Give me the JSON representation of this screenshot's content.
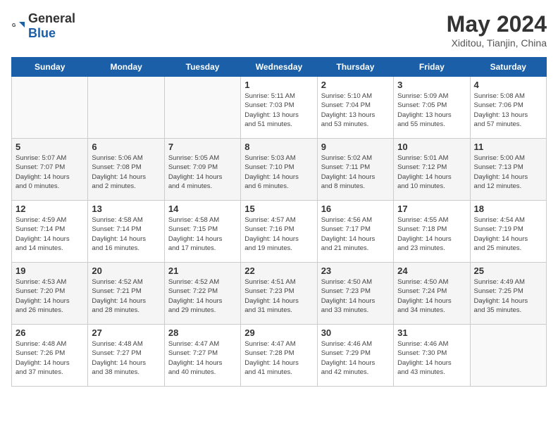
{
  "header": {
    "logo_general": "General",
    "logo_blue": "Blue",
    "title": "May 2024",
    "subtitle": "Xiditou, Tianjin, China"
  },
  "weekdays": [
    "Sunday",
    "Monday",
    "Tuesday",
    "Wednesday",
    "Thursday",
    "Friday",
    "Saturday"
  ],
  "weeks": [
    [
      {
        "day": "",
        "info": ""
      },
      {
        "day": "",
        "info": ""
      },
      {
        "day": "",
        "info": ""
      },
      {
        "day": "1",
        "info": "Sunrise: 5:11 AM\nSunset: 7:03 PM\nDaylight: 13 hours\nand 51 minutes."
      },
      {
        "day": "2",
        "info": "Sunrise: 5:10 AM\nSunset: 7:04 PM\nDaylight: 13 hours\nand 53 minutes."
      },
      {
        "day": "3",
        "info": "Sunrise: 5:09 AM\nSunset: 7:05 PM\nDaylight: 13 hours\nand 55 minutes."
      },
      {
        "day": "4",
        "info": "Sunrise: 5:08 AM\nSunset: 7:06 PM\nDaylight: 13 hours\nand 57 minutes."
      }
    ],
    [
      {
        "day": "5",
        "info": "Sunrise: 5:07 AM\nSunset: 7:07 PM\nDaylight: 14 hours\nand 0 minutes."
      },
      {
        "day": "6",
        "info": "Sunrise: 5:06 AM\nSunset: 7:08 PM\nDaylight: 14 hours\nand 2 minutes."
      },
      {
        "day": "7",
        "info": "Sunrise: 5:05 AM\nSunset: 7:09 PM\nDaylight: 14 hours\nand 4 minutes."
      },
      {
        "day": "8",
        "info": "Sunrise: 5:03 AM\nSunset: 7:10 PM\nDaylight: 14 hours\nand 6 minutes."
      },
      {
        "day": "9",
        "info": "Sunrise: 5:02 AM\nSunset: 7:11 PM\nDaylight: 14 hours\nand 8 minutes."
      },
      {
        "day": "10",
        "info": "Sunrise: 5:01 AM\nSunset: 7:12 PM\nDaylight: 14 hours\nand 10 minutes."
      },
      {
        "day": "11",
        "info": "Sunrise: 5:00 AM\nSunset: 7:13 PM\nDaylight: 14 hours\nand 12 minutes."
      }
    ],
    [
      {
        "day": "12",
        "info": "Sunrise: 4:59 AM\nSunset: 7:14 PM\nDaylight: 14 hours\nand 14 minutes."
      },
      {
        "day": "13",
        "info": "Sunrise: 4:58 AM\nSunset: 7:14 PM\nDaylight: 14 hours\nand 16 minutes."
      },
      {
        "day": "14",
        "info": "Sunrise: 4:58 AM\nSunset: 7:15 PM\nDaylight: 14 hours\nand 17 minutes."
      },
      {
        "day": "15",
        "info": "Sunrise: 4:57 AM\nSunset: 7:16 PM\nDaylight: 14 hours\nand 19 minutes."
      },
      {
        "day": "16",
        "info": "Sunrise: 4:56 AM\nSunset: 7:17 PM\nDaylight: 14 hours\nand 21 minutes."
      },
      {
        "day": "17",
        "info": "Sunrise: 4:55 AM\nSunset: 7:18 PM\nDaylight: 14 hours\nand 23 minutes."
      },
      {
        "day": "18",
        "info": "Sunrise: 4:54 AM\nSunset: 7:19 PM\nDaylight: 14 hours\nand 25 minutes."
      }
    ],
    [
      {
        "day": "19",
        "info": "Sunrise: 4:53 AM\nSunset: 7:20 PM\nDaylight: 14 hours\nand 26 minutes."
      },
      {
        "day": "20",
        "info": "Sunrise: 4:52 AM\nSunset: 7:21 PM\nDaylight: 14 hours\nand 28 minutes."
      },
      {
        "day": "21",
        "info": "Sunrise: 4:52 AM\nSunset: 7:22 PM\nDaylight: 14 hours\nand 29 minutes."
      },
      {
        "day": "22",
        "info": "Sunrise: 4:51 AM\nSunset: 7:23 PM\nDaylight: 14 hours\nand 31 minutes."
      },
      {
        "day": "23",
        "info": "Sunrise: 4:50 AM\nSunset: 7:23 PM\nDaylight: 14 hours\nand 33 minutes."
      },
      {
        "day": "24",
        "info": "Sunrise: 4:50 AM\nSunset: 7:24 PM\nDaylight: 14 hours\nand 34 minutes."
      },
      {
        "day": "25",
        "info": "Sunrise: 4:49 AM\nSunset: 7:25 PM\nDaylight: 14 hours\nand 35 minutes."
      }
    ],
    [
      {
        "day": "26",
        "info": "Sunrise: 4:48 AM\nSunset: 7:26 PM\nDaylight: 14 hours\nand 37 minutes."
      },
      {
        "day": "27",
        "info": "Sunrise: 4:48 AM\nSunset: 7:27 PM\nDaylight: 14 hours\nand 38 minutes."
      },
      {
        "day": "28",
        "info": "Sunrise: 4:47 AM\nSunset: 7:27 PM\nDaylight: 14 hours\nand 40 minutes."
      },
      {
        "day": "29",
        "info": "Sunrise: 4:47 AM\nSunset: 7:28 PM\nDaylight: 14 hours\nand 41 minutes."
      },
      {
        "day": "30",
        "info": "Sunrise: 4:46 AM\nSunset: 7:29 PM\nDaylight: 14 hours\nand 42 minutes."
      },
      {
        "day": "31",
        "info": "Sunrise: 4:46 AM\nSunset: 7:30 PM\nDaylight: 14 hours\nand 43 minutes."
      },
      {
        "day": "",
        "info": ""
      }
    ]
  ]
}
